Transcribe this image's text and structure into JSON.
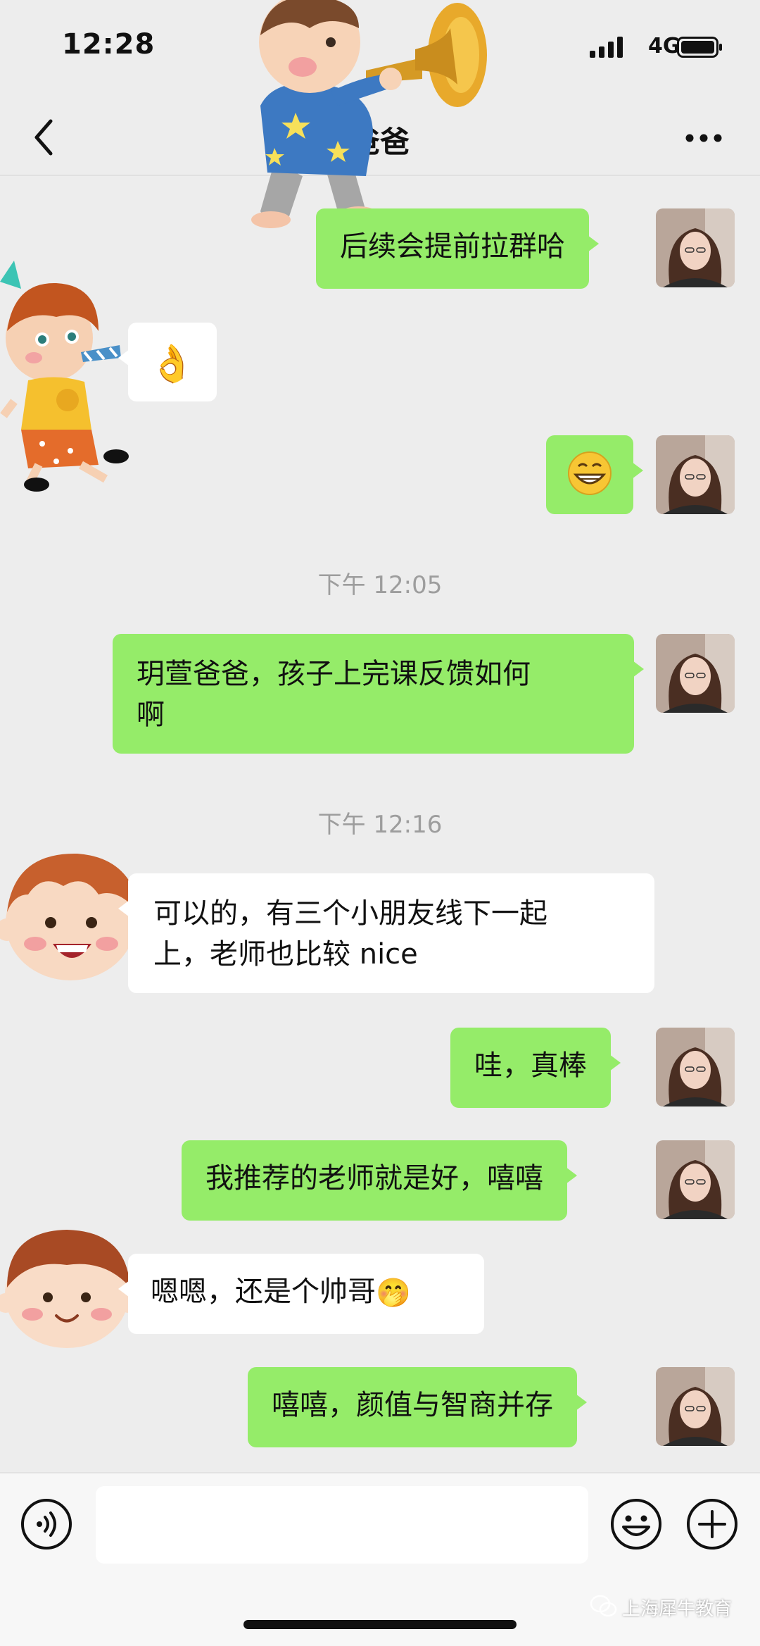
{
  "status_bar": {
    "time": "12:28",
    "network": "4G"
  },
  "header": {
    "title": "爸爸"
  },
  "messages": [
    {
      "side": "out",
      "text": "后续会提前拉群哈"
    },
    {
      "side": "in",
      "emoji": "👌"
    },
    {
      "side": "out",
      "emoji": "😁"
    },
    {
      "type": "time",
      "text": "下午 12:05"
    },
    {
      "side": "out",
      "text_line1": "玥萱爸爸，孩子上完课反馈如何",
      "text_line2": "啊"
    },
    {
      "type": "time",
      "text": "下午 12:16"
    },
    {
      "side": "in",
      "text_line1": "可以的，有三个小朋友线下一起",
      "text_line2": "上，老师也比较 nice"
    },
    {
      "side": "out",
      "text": "哇，真棒"
    },
    {
      "side": "out",
      "text": "我推荐的老师就是好，嘻嘻"
    },
    {
      "side": "in",
      "text": "嗯嗯，还是个帅哥",
      "emoji": "🤭"
    },
    {
      "side": "out",
      "text": "嘻嘻，颜值与智商并存"
    }
  ],
  "input": {
    "placeholder": ""
  },
  "watermark": {
    "text": "上海犀牛教育"
  },
  "colors": {
    "outgoing_bubble": "#95ec69",
    "incoming_bubble": "#ffffff",
    "background": "#ededed"
  }
}
